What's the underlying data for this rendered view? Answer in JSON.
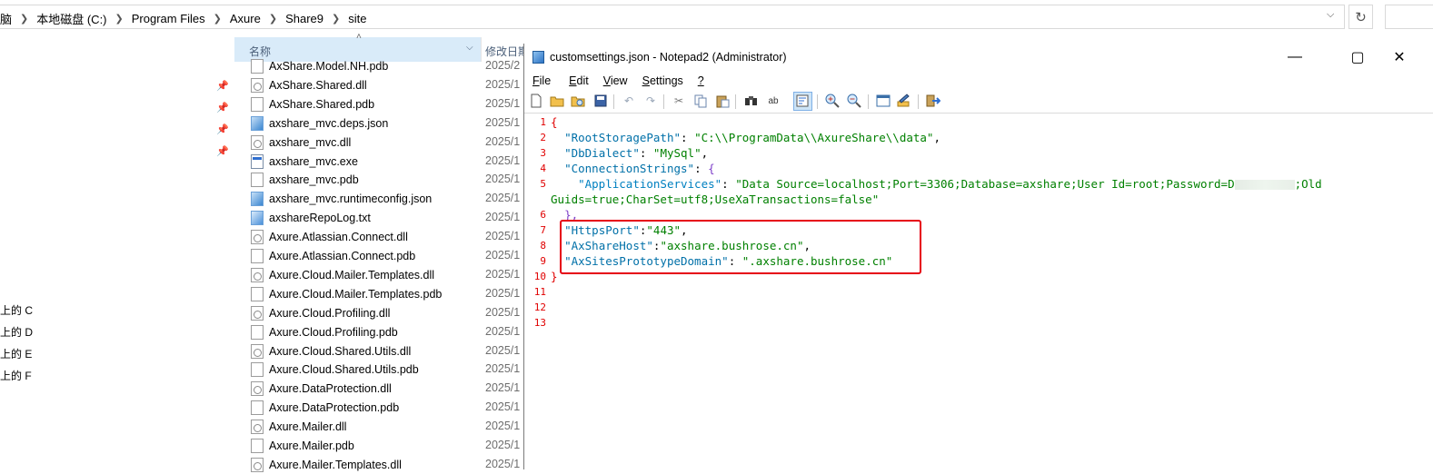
{
  "explorer": {
    "breadcrumb": [
      "脑",
      "本地磁盘 (C:)",
      "Program Files",
      "Axure",
      "Share9",
      "site"
    ],
    "columns": {
      "name": "名称",
      "date": "修改日期"
    },
    "nav_drives": [
      "上的 C",
      "上的 D",
      "上的 E",
      "上的 F"
    ],
    "files": [
      {
        "name": "AxShare.Model.NH.pdb",
        "type": "doc",
        "date": "2025/2"
      },
      {
        "name": "AxShare.Shared.dll",
        "type": "dll",
        "date": "2025/1"
      },
      {
        "name": "AxShare.Shared.pdb",
        "type": "doc",
        "date": "2025/1"
      },
      {
        "name": "axshare_mvc.deps.json",
        "type": "json",
        "date": "2025/1"
      },
      {
        "name": "axshare_mvc.dll",
        "type": "dll",
        "date": "2025/1"
      },
      {
        "name": "axshare_mvc.exe",
        "type": "exe",
        "date": "2025/1"
      },
      {
        "name": "axshare_mvc.pdb",
        "type": "doc",
        "date": "2025/1"
      },
      {
        "name": "axshare_mvc.runtimeconfig.json",
        "type": "json",
        "date": "2025/1"
      },
      {
        "name": "axshareRepoLog.txt",
        "type": "txt",
        "date": "2025/1"
      },
      {
        "name": "Axure.Atlassian.Connect.dll",
        "type": "dll",
        "date": "2025/1"
      },
      {
        "name": "Axure.Atlassian.Connect.pdb",
        "type": "doc",
        "date": "2025/1"
      },
      {
        "name": "Axure.Cloud.Mailer.Templates.dll",
        "type": "dll",
        "date": "2025/1"
      },
      {
        "name": "Axure.Cloud.Mailer.Templates.pdb",
        "type": "doc",
        "date": "2025/1"
      },
      {
        "name": "Axure.Cloud.Profiling.dll",
        "type": "dll",
        "date": "2025/1"
      },
      {
        "name": "Axure.Cloud.Profiling.pdb",
        "type": "doc",
        "date": "2025/1"
      },
      {
        "name": "Axure.Cloud.Shared.Utils.dll",
        "type": "dll",
        "date": "2025/1"
      },
      {
        "name": "Axure.Cloud.Shared.Utils.pdb",
        "type": "doc",
        "date": "2025/1"
      },
      {
        "name": "Axure.DataProtection.dll",
        "type": "dll",
        "date": "2025/1"
      },
      {
        "name": "Axure.DataProtection.pdb",
        "type": "doc",
        "date": "2025/1"
      },
      {
        "name": "Axure.Mailer.dll",
        "type": "dll",
        "date": "2025/1"
      },
      {
        "name": "Axure.Mailer.pdb",
        "type": "doc",
        "date": "2025/1"
      },
      {
        "name": "Axure.Mailer.Templates.dll",
        "type": "dll",
        "date": "2025/1"
      }
    ]
  },
  "notepad": {
    "title": "customsettings.json - Notepad2 (Administrator)",
    "menu": [
      {
        "label": "File",
        "accel": "F",
        "rest": "ile"
      },
      {
        "label": "Edit",
        "accel": "E",
        "rest": "dit"
      },
      {
        "label": "View",
        "accel": "V",
        "rest": "iew"
      },
      {
        "label": "Settings",
        "accel": "S",
        "rest": "ettings"
      },
      {
        "label": "?",
        "accel": "?",
        "rest": ""
      }
    ],
    "line_numbers": [
      "1",
      "2",
      "3",
      "4",
      "5",
      "6",
      "7",
      "8",
      "9",
      "10",
      "11",
      "12",
      "13"
    ],
    "code": {
      "l1": "{",
      "l2_key": "\"RootStoragePath\"",
      "l2_colon": ": ",
      "l2_val": "\"C:\\\\ProgramData\\\\AxureShare\\\\data\"",
      "l2_comma": ",",
      "l3_key": "\"DbDialect\"",
      "l3_colon": ": ",
      "l3_val": "\"MySql\"",
      "l3_comma": ",",
      "l4_key": "\"ConnectionStrings\"",
      "l4_colon": ": ",
      "l4_brace": "{",
      "l5_key": "\"ApplicationServices\"",
      "l5_colon": ": ",
      "l5_val_a": "\"Data Source=localhost;Port=3306;Database=axshare;User Id=root;Password=",
      "l5_val_a_tail": "D",
      "l5_val_b": ";Old",
      "l5_wrap": "Guids=true;CharSet=utf8;UseXaTransactions=false\"",
      "l6": "},",
      "l7_key": "\"HttpsPort\"",
      "l7_colon": ":",
      "l7_val": "\"443\"",
      "l7_comma": ",",
      "l8_key": "\"AxShareHost\"",
      "l8_colon": ":",
      "l8_val": "\"axshare.bushrose.cn\"",
      "l8_comma": ",",
      "l9_key": "\"AxSitesPrototypeDomain\"",
      "l9_colon": ": ",
      "l9_val": "\".axshare.bushrose.cn\"",
      "l10": "}"
    }
  },
  "colors": {
    "highlight_box": "#e60012",
    "line_number": "#e00000",
    "json_key": "#0070a8",
    "json_string": "#008000"
  }
}
